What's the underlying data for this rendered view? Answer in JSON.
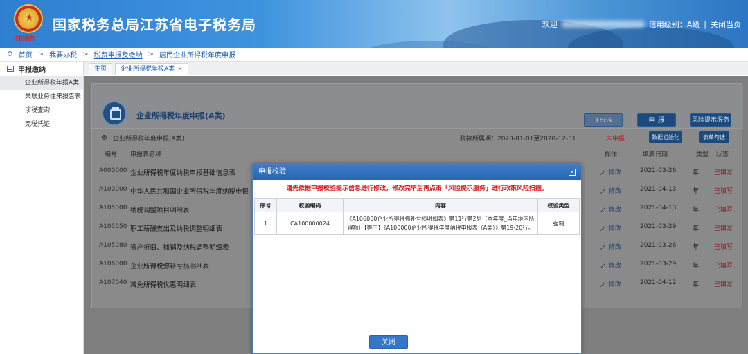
{
  "header": {
    "emblem_text": "中国税务",
    "title": "国家税务总局江苏省电子税务局",
    "welcome": "欢迎",
    "credit": "信用级别：A级",
    "separator": "|",
    "close_page": "关闭当页"
  },
  "breadcrumb": {
    "items": [
      "首页",
      "我要办税",
      "税费申报及缴纳",
      "居民企业所得税年度申报"
    ],
    "sep": ">"
  },
  "sidebar": {
    "title": "申报缴纳",
    "items": [
      "企业所得税年报A类",
      "关联业务往来报告表",
      "涉税查询",
      "完税凭证"
    ]
  },
  "tabs": {
    "home": "主页",
    "active": "企业所得税年报A类",
    "close": "×"
  },
  "form": {
    "title": "企业所得税年度申报(A类)",
    "timer": "168s",
    "declare": "申 报",
    "risk": "风险提示服务",
    "option": "企业所得税年度申报(A类)",
    "period": "税款所属期：2020-01-01至2020-12-31",
    "status": "未申报",
    "init": "数据初始化",
    "select": "表单勾选"
  },
  "table": {
    "headers": [
      "编号",
      "申报表名称",
      "操作",
      "填表日期",
      "类型",
      "状态"
    ],
    "rows": [
      {
        "code": "A000000",
        "name": "企业所得税年度纳税申报基础信息表",
        "action": "修改",
        "date": "2021-03-26",
        "type": "年",
        "status": "已填写"
      },
      {
        "code": "A100000",
        "name": "中华人民共和国企业所得税年度纳税申报",
        "action": "修改",
        "date": "2021-04-13",
        "type": "年",
        "status": "已填写"
      },
      {
        "code": "A105000",
        "name": "纳税调整项目明细表",
        "action": "修改",
        "date": "2021-04-13",
        "type": "年",
        "status": "已填写"
      },
      {
        "code": "A105050",
        "name": "职工薪酬支出及纳税调整明细表",
        "action": "修改",
        "date": "2021-03-29",
        "type": "年",
        "status": "已填写"
      },
      {
        "code": "A105080",
        "name": "资产折旧、摊销及纳税调整明细表",
        "action": "修改",
        "date": "2021-03-26",
        "type": "年",
        "status": "已填写"
      },
      {
        "code": "A106000",
        "name": "企业所得税弥补亏损明细表",
        "action": "修改",
        "date": "2021-03-29",
        "type": "年",
        "status": "已填写"
      },
      {
        "code": "A107040",
        "name": "减免所得税优惠明细表",
        "action": "修改",
        "date": "2021-04-12",
        "type": "年",
        "status": "已填写"
      }
    ]
  },
  "modal": {
    "title": "申报校验",
    "close_icon": "×",
    "message": "请先依据申报校验提示信息进行修改，修改完毕后再点击「风险提示服务」进行政策风险扫描。",
    "columns": [
      "序号",
      "校验编码",
      "内容",
      "校验类型"
    ],
    "rows": [
      {
        "no": "1",
        "code": "CA100000024",
        "content": "《A106000企业所得税弥补亏损明细表》第11行第2列（本年度_当年境内所得额）【等于】《A100000企业所得税年度纳税申报表（A类）》第19-20行。",
        "type": "强制"
      }
    ],
    "close_button": "关闭"
  }
}
